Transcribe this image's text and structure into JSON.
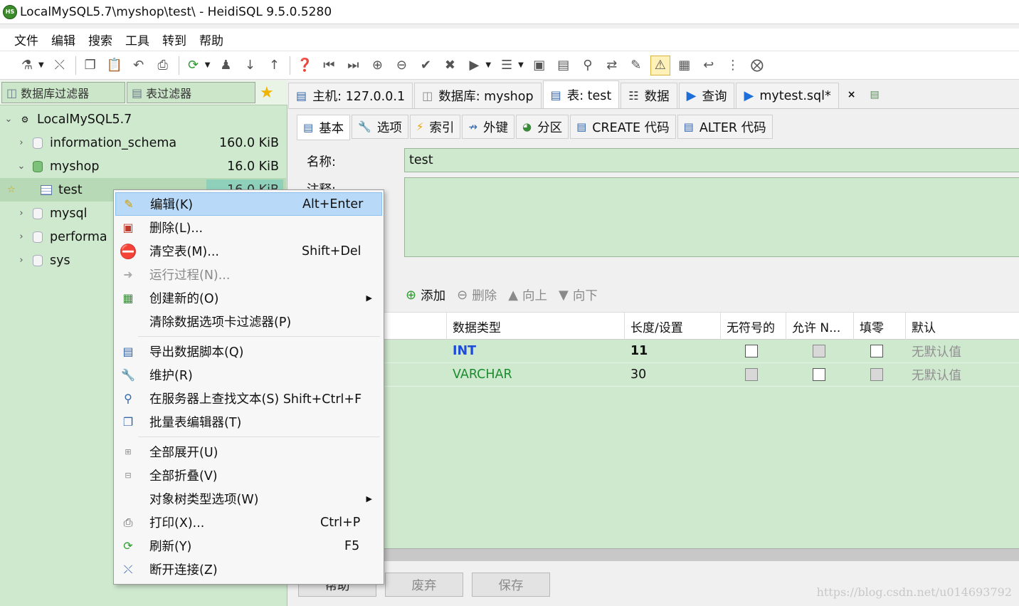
{
  "window": {
    "title": "LocalMySQL5.7\\myshop\\test\\ - HeidiSQL 9.5.0.5280",
    "logo_text": "HS"
  },
  "menubar": [
    "文件",
    "编辑",
    "搜索",
    "工具",
    "转到",
    "帮助"
  ],
  "left": {
    "filters": {
      "db_filter": "数据库过滤器",
      "table_filter": "表过滤器"
    },
    "tree": {
      "server": "LocalMySQL5.7",
      "items": [
        {
          "name": "information_schema",
          "size": "160.0 KiB"
        },
        {
          "name": "myshop",
          "size": "16.0 KiB"
        },
        {
          "name": "test",
          "size": "16.0 KiB"
        },
        {
          "name": "mysql"
        },
        {
          "name": "performa"
        },
        {
          "name": "sys"
        }
      ]
    }
  },
  "doc_tabs": [
    {
      "label": "主机: 127.0.0.1"
    },
    {
      "label": "数据库: myshop"
    },
    {
      "label": "表: test"
    },
    {
      "label": "数据"
    },
    {
      "label": "查询"
    },
    {
      "label": "mytest.sql*"
    }
  ],
  "close_glyph": "×",
  "sub_tabs": [
    "基本",
    "选项",
    "索引",
    "外键",
    "分区",
    "CREATE 代码",
    "ALTER 代码"
  ],
  "form": {
    "name_label": "名称:",
    "name_value": "test",
    "comment_label": "注释:"
  },
  "column_actions": {
    "add": "添加",
    "remove": "删除",
    "up": "向上",
    "down": "向下"
  },
  "columns_grid": {
    "headers": [
      "数据类型",
      "长度/设置",
      "无符号的",
      "允许 N...",
      "填零",
      "默认"
    ],
    "rows": [
      {
        "type": "INT",
        "length": "11",
        "default": "无默认值"
      },
      {
        "type": "VARCHAR",
        "length": "30",
        "default": "无默认值"
      }
    ]
  },
  "bottom_buttons": {
    "help": "帮助",
    "discard": "废弃",
    "save": "保存"
  },
  "watermark": "https://blog.csdn.net/u014693792",
  "context_menu": {
    "items": [
      {
        "label": "编辑(K)",
        "shortcut": "Alt+Enter"
      },
      {
        "label": "删除(L)..."
      },
      {
        "label": "清空表(M)...",
        "shortcut": "Shift+Del"
      },
      {
        "label": "运行过程(N)..."
      },
      {
        "label": "创建新的(O)"
      },
      {
        "label": "清除数据选项卡过滤器(P)"
      },
      {
        "label": "导出数据脚本(Q)"
      },
      {
        "label": "维护(R)"
      },
      {
        "label": "在服务器上查找文本(S) Shift+Ctrl+F"
      },
      {
        "label": "批量表编辑器(T)"
      },
      {
        "label": "全部展开(U)"
      },
      {
        "label": "全部折叠(V)"
      },
      {
        "label": "对象树类型选项(W)"
      },
      {
        "label": "打印(X)...",
        "shortcut": "Ctrl+P"
      },
      {
        "label": "刷新(Y)",
        "shortcut": "F5"
      },
      {
        "label": "断开连接(Z)"
      }
    ]
  }
}
